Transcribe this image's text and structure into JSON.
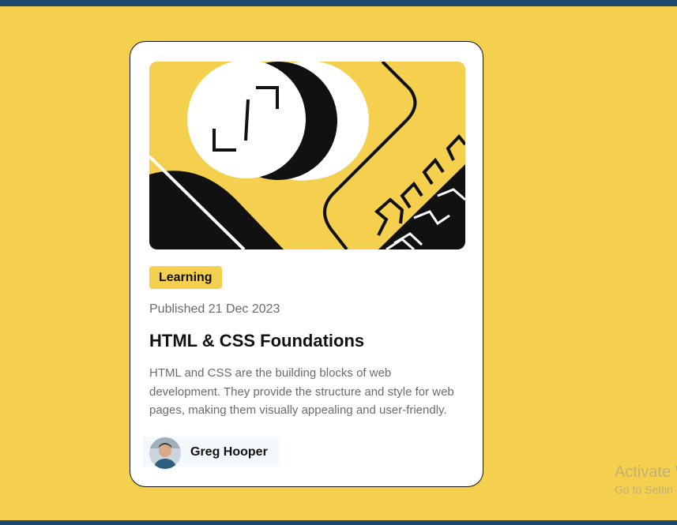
{
  "card": {
    "tag": "Learning",
    "published": "Published 21 Dec 2023",
    "title": "HTML & CSS Foundations",
    "description": "HTML and CSS are the building blocks of web development. They provide the structure and style for web pages, making them visually appealing and user-friendly.",
    "author": "Greg Hooper"
  },
  "watermark": {
    "title": "Activate W",
    "subtitle": "Go to Settin"
  },
  "colors": {
    "background": "#f4d04e",
    "card": "#ffffff",
    "text": "#111111",
    "muted": "#6b6b6b",
    "taskbar": "#1c4a6e"
  }
}
